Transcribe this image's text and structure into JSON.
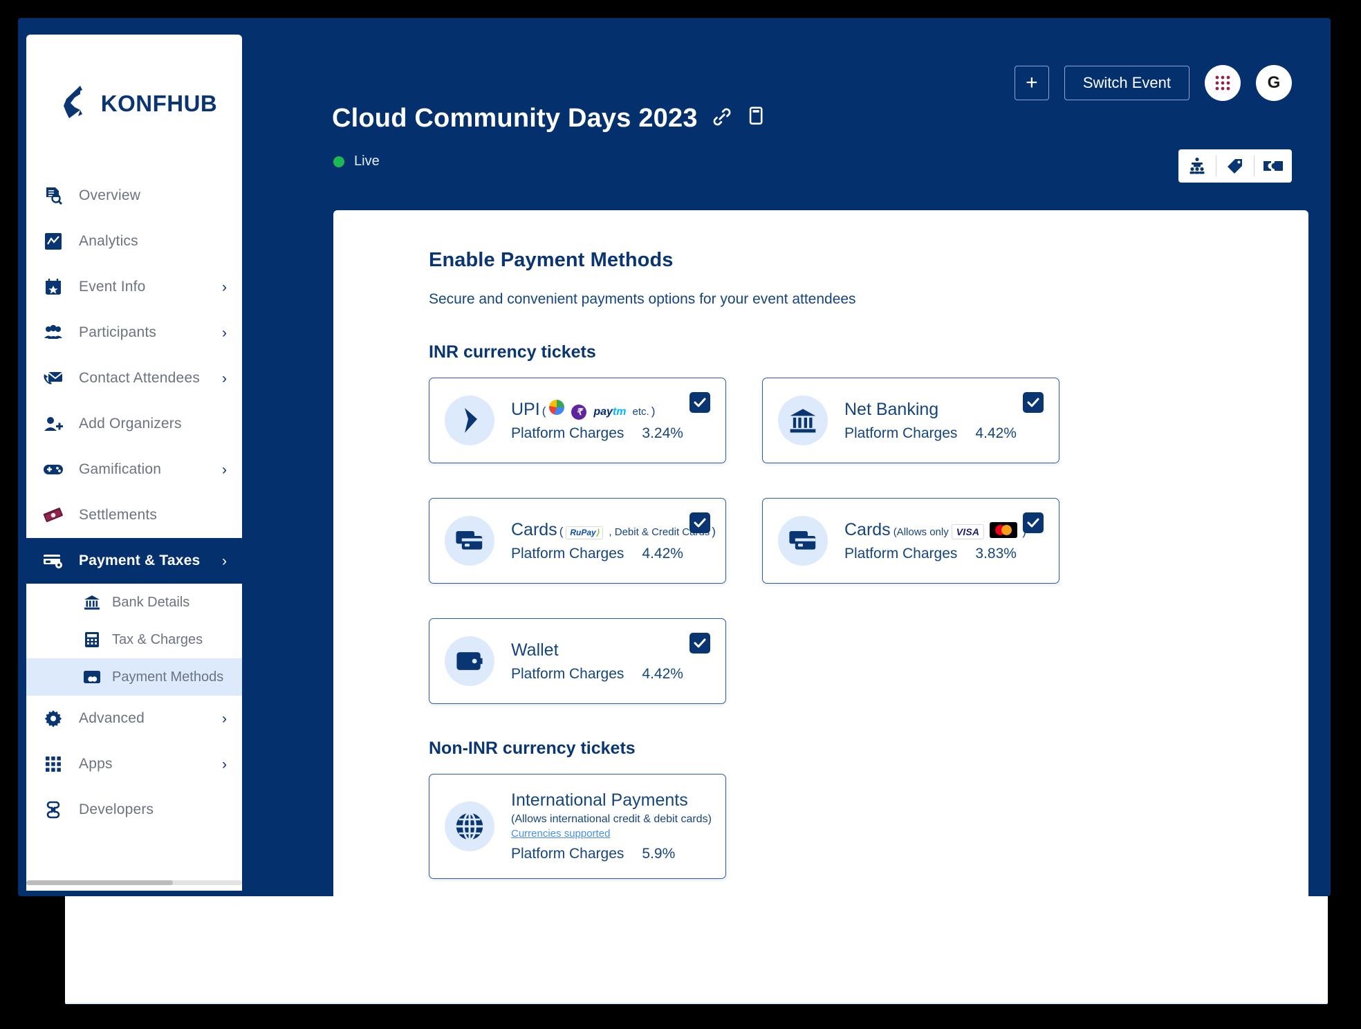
{
  "brand": {
    "name": "KONFHUB",
    "logo_color": "#0a3573"
  },
  "header": {
    "event_title": "Cloud Community Days 2023",
    "status_label": "Live",
    "status_color": "#1db954",
    "link_icon": "link-icon",
    "copy_icon": "copy-icon",
    "add_button_label": "+",
    "switch_event_label": "Switch Event",
    "apps_grid_icon": "apps-grid-icon",
    "avatar_initial": "G",
    "view_toggle": [
      {
        "icon": "audience-icon",
        "name": "view-toggle-audience"
      },
      {
        "icon": "tag-icon",
        "name": "view-toggle-tag"
      },
      {
        "icon": "ticket-icon",
        "name": "view-toggle-ticket"
      }
    ]
  },
  "sidebar": {
    "items": [
      {
        "label": "Overview",
        "icon": "overview-icon",
        "chevron": false,
        "active": false
      },
      {
        "label": "Analytics",
        "icon": "analytics-icon",
        "chevron": false,
        "active": false
      },
      {
        "label": "Event Info",
        "icon": "calendar-star-icon",
        "chevron": true,
        "active": false
      },
      {
        "label": "Participants",
        "icon": "people-icon",
        "chevron": true,
        "active": false
      },
      {
        "label": "Contact Attendees",
        "icon": "mail-phone-icon",
        "chevron": true,
        "active": false
      },
      {
        "label": "Add Organizers",
        "icon": "add-person-icon",
        "chevron": false,
        "active": false
      },
      {
        "label": "Gamification",
        "icon": "gamepad-icon",
        "chevron": true,
        "active": false
      },
      {
        "label": "Settlements",
        "icon": "money-icon",
        "chevron": false,
        "active": false
      },
      {
        "label": "Payment & Taxes",
        "icon": "card-gear-icon",
        "chevron": true,
        "active": true
      }
    ],
    "sub_items": [
      {
        "label": "Bank Details",
        "icon": "bank-icon",
        "selected": false
      },
      {
        "label": "Tax & Charges",
        "icon": "calculator-icon",
        "selected": false
      },
      {
        "label": "Payment Methods",
        "icon": "payment-card-icon",
        "selected": true
      }
    ],
    "items_after": [
      {
        "label": "Advanced",
        "icon": "gear-icon",
        "chevron": true,
        "active": false
      },
      {
        "label": "Apps",
        "icon": "grid-icon",
        "chevron": true,
        "active": false
      },
      {
        "label": "Developers",
        "icon": "developers-icon",
        "chevron": false,
        "active": false
      }
    ],
    "chevron_glyph": "›"
  },
  "main": {
    "heading": "Enable Payment Methods",
    "subheading": "Secure and convenient payments options for your event attendees",
    "sections": [
      {
        "title": "INR currency tickets",
        "cards": [
          {
            "name": "upi",
            "icon": "upi-arrow-icon",
            "title": "UPI",
            "paren_open": "(",
            "brands": [
              "gpay",
              "phonepe",
              "paytm"
            ],
            "brand_note": "etc.",
            "paren_close": ")",
            "charges_label": "Platform Charges",
            "charges_value": "3.24%",
            "checked": true
          },
          {
            "name": "net-banking",
            "icon": "bank-icon",
            "title": "Net Banking",
            "charges_label": "Platform Charges",
            "charges_value": "4.42%",
            "checked": true
          },
          {
            "name": "cards-rupay",
            "icon": "cards-icon",
            "title": "Cards",
            "paren_open": "(",
            "brands": [
              "rupay"
            ],
            "brand_note": ", Debit & Credit Cards",
            "paren_close": ")",
            "charges_label": "Platform Charges",
            "charges_value": "4.42%",
            "checked": true
          },
          {
            "name": "cards-visa-mastercard",
            "icon": "cards-icon",
            "title": "Cards",
            "paren_open": "(Allows only",
            "brands": [
              "visa",
              "mastercard"
            ],
            "brand_note": "",
            "paren_close": ")",
            "charges_label": "Platform Charges",
            "charges_value": "3.83%",
            "checked": true
          },
          {
            "name": "wallet",
            "icon": "wallet-icon",
            "title": "Wallet",
            "charges_label": "Platform Charges",
            "charges_value": "4.42%",
            "checked": true
          }
        ]
      },
      {
        "title": "Non-INR currency tickets",
        "cards": [
          {
            "name": "international-payments",
            "icon": "globe-icon",
            "title": "International Payments",
            "sub": "(Allows international credit & debit cards)",
            "link": "Currencies supported",
            "charges_label": "Platform Charges",
            "charges_value": "5.9%",
            "checked": false
          }
        ]
      }
    ]
  },
  "colors": {
    "navy": "#04306e",
    "navy_text": "#0a3573",
    "card_border": "#2a5ea4",
    "icon_bg": "#dceafb",
    "selected_sub_bg": "#dceafb"
  }
}
